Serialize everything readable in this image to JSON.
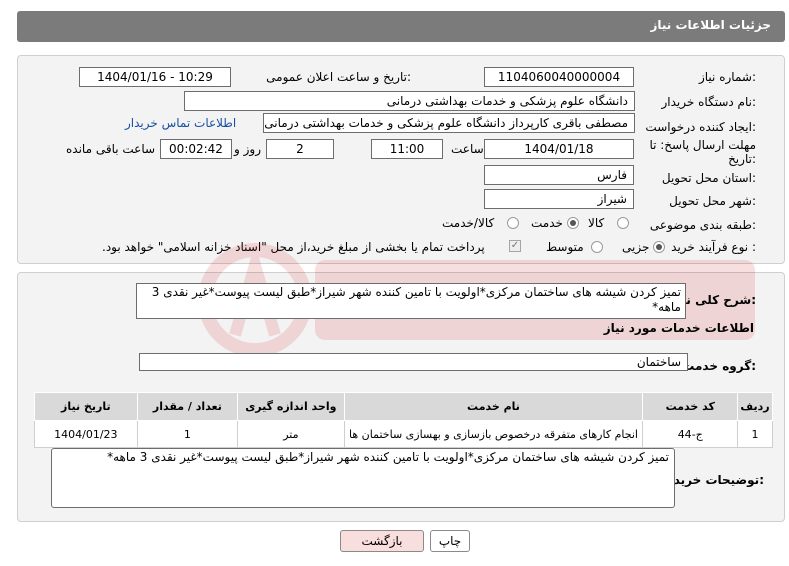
{
  "header": {
    "title": "جزئیات اطلاعات نیاز"
  },
  "form": {
    "need_number_label": "شماره نیاز:",
    "need_number": "1104060040000004",
    "announce_label": "تاریخ و ساعت اعلان عمومی:",
    "announce_value": "1404/01/16 - 10:29",
    "buyer_org_label": "نام دستگاه خریدار:",
    "buyer_org": "دانشگاه علوم پزشکی و خدمات بهداشتی درمانی",
    "creator_label": "ایجاد کننده درخواست:",
    "creator": "مصطفی باقری کارپرداز دانشگاه علوم پزشکی و خدمات بهداشتی درمانی",
    "contact_link": "اطلاعات تماس خریدار",
    "deadline_label_1": "مهلت ارسال پاسخ: تا",
    "deadline_label_2": "تاریخ:",
    "deadline_date": "1404/01/18",
    "time_label": "ساعت",
    "deadline_time": "11:00",
    "days_value": "2",
    "days_label": "روز و",
    "remaining_time": "00:02:42",
    "remaining_label": "ساعت باقی مانده",
    "province_label": "استان محل تحویل:",
    "province": "فارس",
    "city_label": "شهر محل تحویل:",
    "city": "شیراز",
    "category_label": "طبقه بندی موضوعی:",
    "category_options": [
      "کالا",
      "خدمت",
      "کالا/خدمت"
    ],
    "process_label": "نوع فرآیند خرید :",
    "process_options": [
      "جزیی",
      "متوسط"
    ],
    "payment_note": "پرداخت تمام یا بخشی از مبلغ خرید،از محل \"اسناد خزانه اسلامی\" خواهد بود."
  },
  "details": {
    "summary_label": "شرح کلی نیاز:",
    "summary": "تمیز کردن شیشه های ساختمان مرکزی*اولویت با تامین کننده شهر شیراز*طبق لیست پیوست*غیر نقدی 3 ماهه*",
    "services_title": "اطلاعات خدمات مورد نیاز",
    "group_label": "گروه خدمت:",
    "group": "ساختمان",
    "table": {
      "headers": [
        "ردیف",
        "کد خدمت",
        "نام خدمت",
        "واحد اندازه گیری",
        "تعداد / مقدار",
        "تاریخ نیاز"
      ],
      "rows": [
        [
          "1",
          "ج-44",
          "انجام کارهای متفرقه درخصوص بازسازی و بهسازی ساختمان ها",
          "متر",
          "1",
          "1404/01/23"
        ]
      ]
    },
    "buyer_notes_label": "توضیحات خریدار:",
    "buyer_notes": "تمیز کردن شیشه های ساختمان مرکزی*اولویت با تامین کننده شهر شیراز*طبق لیست پیوست*غیر نقدی 3 ماهه*"
  },
  "buttons": {
    "print": "چاپ",
    "back": "بازگشت"
  },
  "colors": {
    "header_bg": "#7b7b7b",
    "panel_bg": "#f3f3f3",
    "link": "#1a4fa3",
    "back_btn": "#f9dede"
  }
}
